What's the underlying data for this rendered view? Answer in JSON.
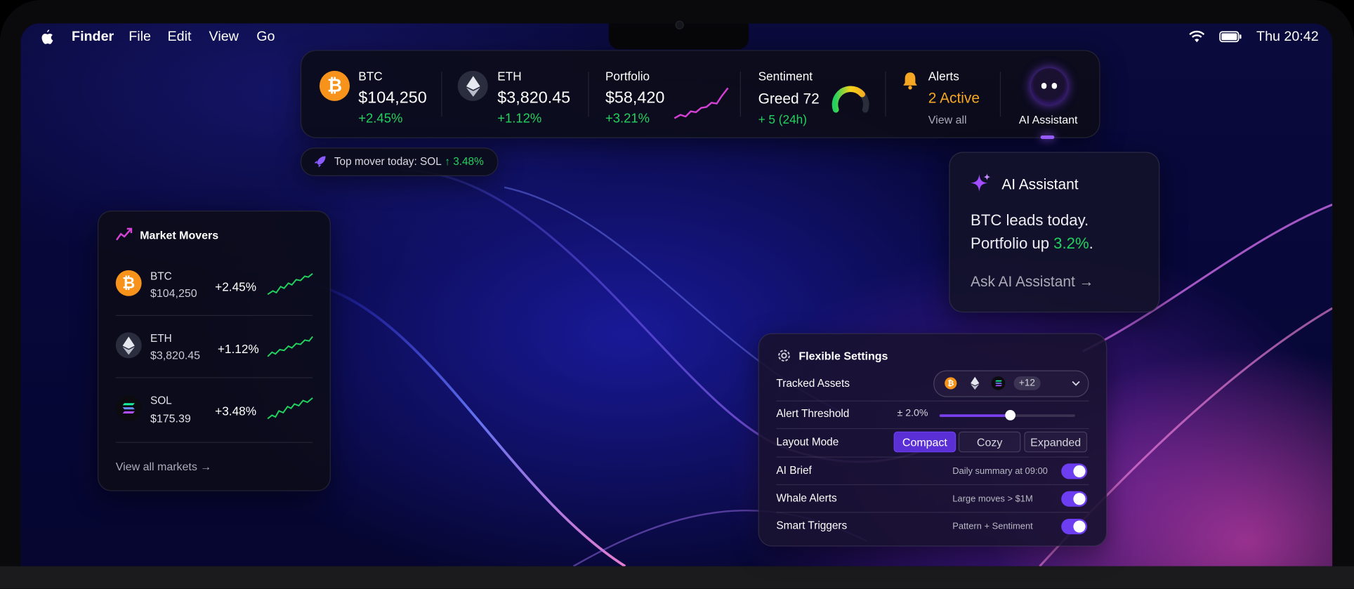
{
  "menubar": {
    "app": "Finder",
    "items": [
      "File",
      "Edit",
      "View",
      "Go"
    ],
    "clock": "Thu 20:42"
  },
  "ticker": {
    "btc": {
      "name": "BTC",
      "price": "$104,250",
      "change": "+2.45%"
    },
    "eth": {
      "name": "ETH",
      "price": "$3,820.45",
      "change": "+1.12%"
    },
    "portfolio": {
      "name": "Portfolio",
      "value": "$58,420",
      "change": "+3.21%"
    },
    "sentiment": {
      "name": "Sentiment",
      "value": "Greed 72",
      "change": "+ 5 (24h)",
      "gauge_level": 72
    },
    "alerts": {
      "name": "Alerts",
      "count": "2 Active",
      "link": "View all"
    },
    "assistant": {
      "label": "AI Assistant"
    }
  },
  "top_mover": {
    "text": "Top mover today: SOL",
    "value": "↑ 3.48%"
  },
  "market_movers": {
    "title": "Market Movers",
    "rows": [
      {
        "symbol": "BTC",
        "price": "$104,250",
        "change": "+2.45%"
      },
      {
        "symbol": "ETH",
        "price": "$3,820.45",
        "change": "+1.12%"
      },
      {
        "symbol": "SOL",
        "price": "$175.39",
        "change": "+3.48%"
      }
    ],
    "view_all": "View all markets →"
  },
  "assistant_popup": {
    "title": "AI Assistant",
    "line1": "BTC leads today.",
    "line2_prefix": "Portfolio up ",
    "line2_value": "3.2%",
    "line2_suffix": ".",
    "ask": "Ask AI Assistant →"
  },
  "settings": {
    "title": "Flexible Settings",
    "tracked_assets": {
      "label": "Tracked Assets",
      "more": "+12"
    },
    "alert_threshold": {
      "label": "Alert Threshold",
      "value": "± 2.0%",
      "slider_level": 0.52
    },
    "layout_mode": {
      "label": "Layout Mode",
      "options": [
        "Compact",
        "Cozy",
        "Expanded"
      ],
      "selected": "Compact"
    },
    "ai_brief": {
      "label": "AI Brief",
      "desc": "Daily summary at 09:00",
      "on": true
    },
    "whale_alerts": {
      "label": "Whale Alerts",
      "desc": "Large moves > $1M",
      "on": true
    },
    "smart_triggers": {
      "label": "Smart Triggers",
      "desc": "Pattern + Sentiment",
      "on": true
    }
  },
  "colors": {
    "positive": "#22d15e",
    "accent": "#7b3ff2",
    "btc": "#f7931a",
    "alert": "#f5a623"
  }
}
